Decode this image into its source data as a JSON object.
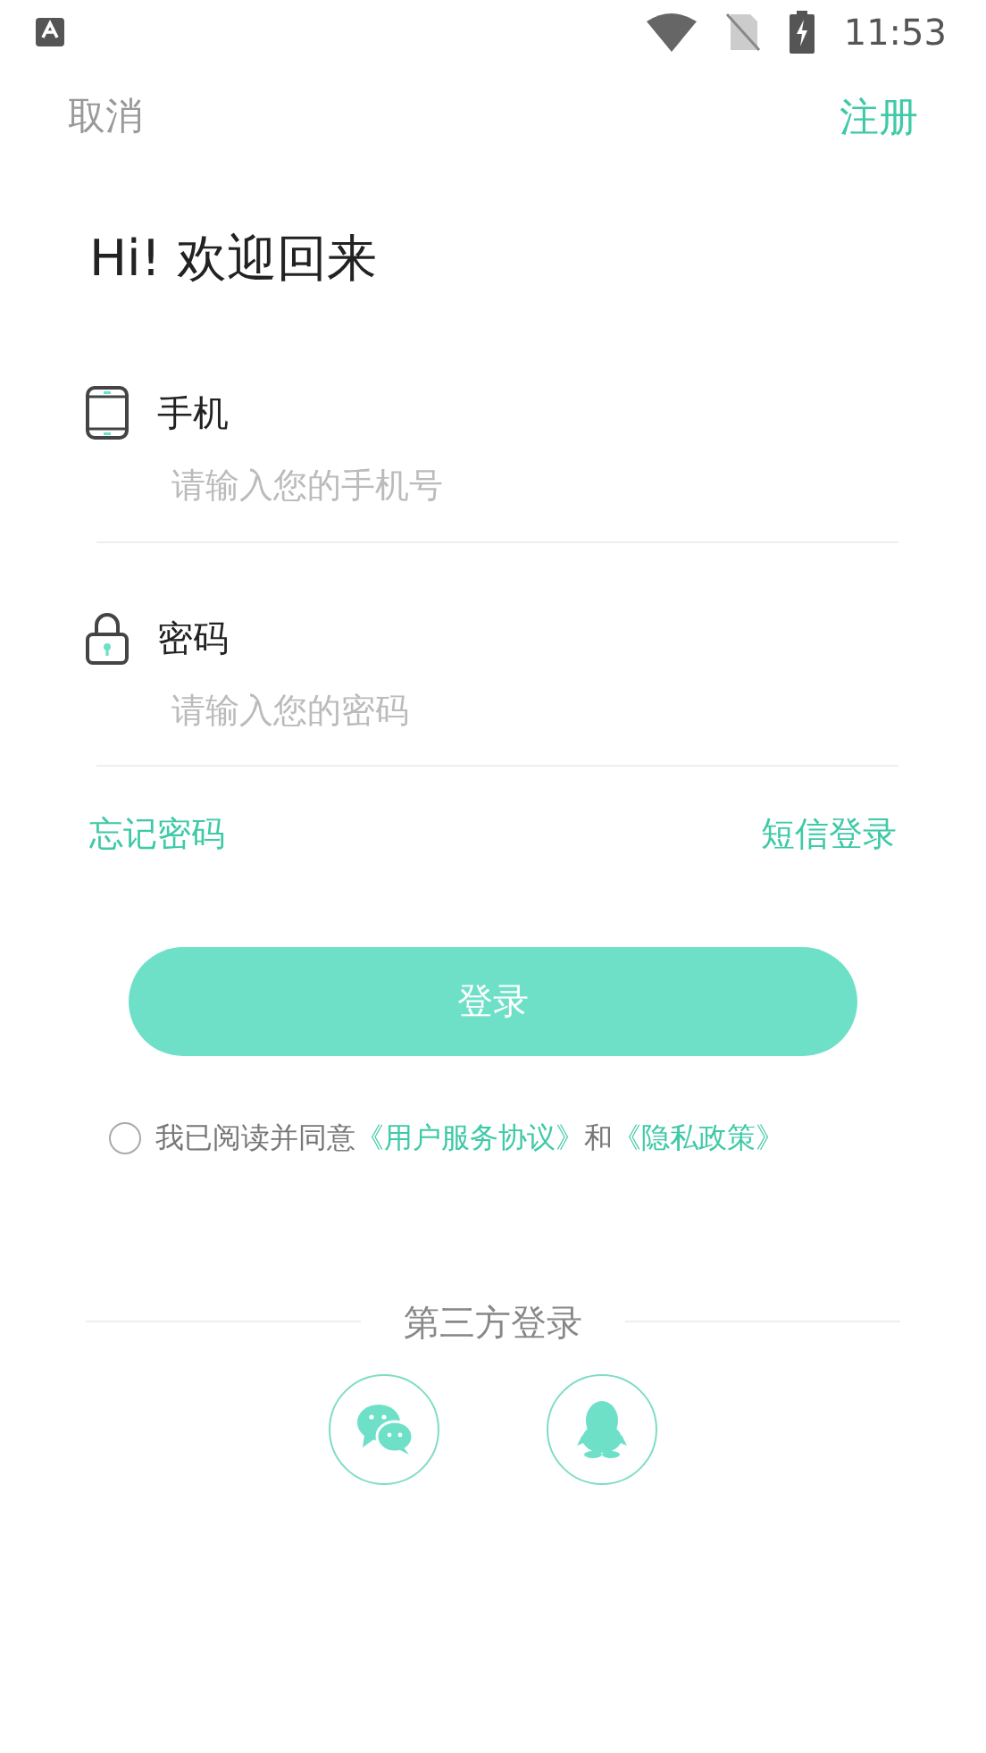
{
  "status_bar": {
    "time": "11:53"
  },
  "nav": {
    "cancel": "取消",
    "register": "注册"
  },
  "greeting": "Hi! 欢迎回来",
  "fields": [
    {
      "kind": "phone",
      "label": "手机",
      "placeholder": "请输入您的手机号"
    },
    {
      "kind": "password",
      "label": "密码",
      "placeholder": "请输入您的密码"
    }
  ],
  "links": {
    "forgot": "忘记密码",
    "sms": "短信登录"
  },
  "login_button": {
    "label": "登录",
    "disabled": true
  },
  "agreement": {
    "checked": false,
    "parts": [
      {
        "kind": "text",
        "text": "我已阅读并同意"
      },
      {
        "kind": "link",
        "text": "《用户服务协议》"
      },
      {
        "kind": "text",
        "text": "和"
      },
      {
        "kind": "link",
        "text": "《隐私政策》"
      }
    ]
  },
  "third_party": {
    "title": "第三方登录",
    "providers": [
      {
        "kind": "chat"
      },
      {
        "kind": "penguin"
      }
    ]
  }
}
